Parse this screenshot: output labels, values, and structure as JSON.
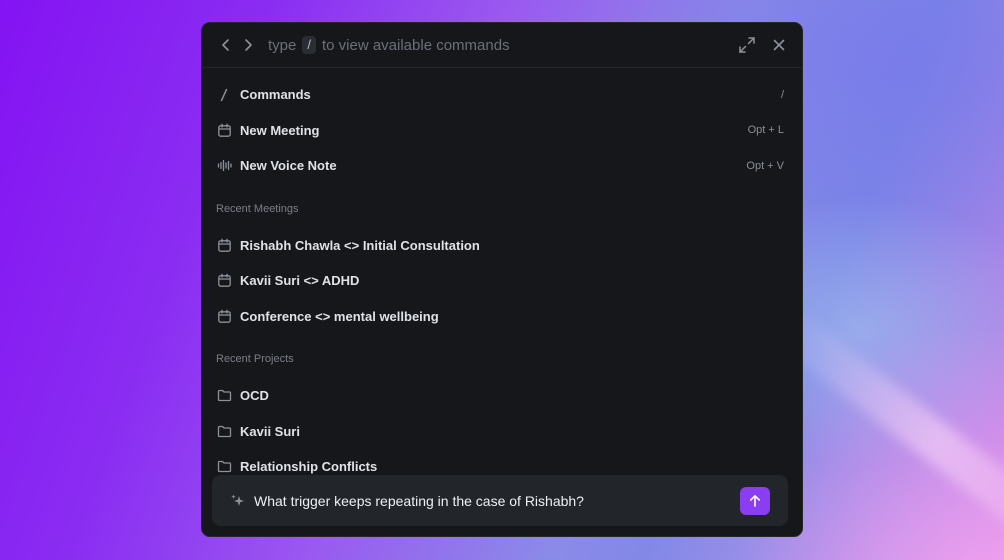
{
  "topbar": {
    "hint_before": "type",
    "hint_key": "/",
    "hint_after": "to view available commands",
    "icons": [
      "chevron-left-icon",
      "chevron-right-icon",
      "expand-icon",
      "close-icon"
    ]
  },
  "actions": [
    {
      "icon": "slash-icon",
      "label": "Commands",
      "shortcut": "/"
    },
    {
      "icon": "calendar-icon",
      "label": "New Meeting",
      "shortcut": "Opt + L"
    },
    {
      "icon": "waveform-icon",
      "label": "New Voice Note",
      "shortcut": "Opt + V"
    }
  ],
  "recent_meetings": {
    "heading": "Recent Meetings",
    "items": [
      {
        "icon": "calendar-icon",
        "label": "Rishabh Chawla <> Initial Consultation"
      },
      {
        "icon": "calendar-icon",
        "label": "Kavii Suri <> ADHD"
      },
      {
        "icon": "calendar-icon",
        "label": "Conference <> mental wellbeing"
      }
    ]
  },
  "recent_projects": {
    "heading": "Recent Projects",
    "items": [
      {
        "icon": "folder-icon",
        "label": "OCD"
      },
      {
        "icon": "folder-icon",
        "label": "Kavii Suri"
      },
      {
        "icon": "folder-icon",
        "label": "Relationship Conflicts"
      }
    ]
  },
  "composer": {
    "text": "What trigger keeps repeating in the case of Rishabh?",
    "icon": "sparkle-icon",
    "send_icon": "arrow-up-icon"
  },
  "colors": {
    "panel_bg": "#15171b",
    "accent": "#8b3df2",
    "text": "#dfe2e7",
    "muted": "#7a7f87"
  }
}
